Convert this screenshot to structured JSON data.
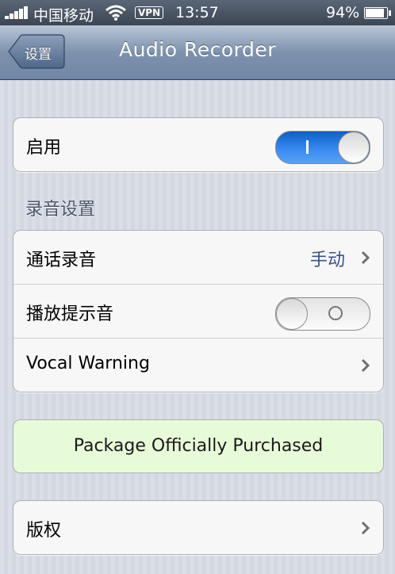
{
  "status_bar": {
    "carrier": "中国移动",
    "vpn": "VPN",
    "time": "13:57",
    "battery": "94%",
    "battery_level": 0.94
  },
  "nav": {
    "back_label": "设置",
    "title": "Audio Recorder"
  },
  "enable_group": {
    "label": "启用",
    "switch_on": true
  },
  "recording_section": {
    "header": "录音设置",
    "rows": [
      {
        "label": "通话录音",
        "value": "手动"
      },
      {
        "label": "播放提示音",
        "switch_on": false
      },
      {
        "label": "Vocal Warning"
      }
    ]
  },
  "purchase_banner": "Package Officially Purchased",
  "copyright_row": {
    "label": "版权"
  },
  "colors": {
    "accent": "#3b8df2",
    "value_text": "#385487",
    "banner_bg": "#e8fbd8"
  }
}
